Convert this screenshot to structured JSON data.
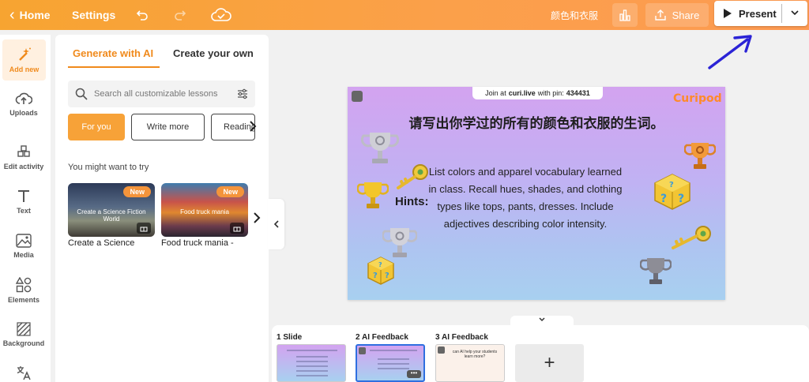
{
  "topbar": {
    "home": "Home",
    "settings": "Settings",
    "title": "颜色和衣服",
    "share": "Share",
    "present": "Present"
  },
  "rail": {
    "items": [
      {
        "label": "Add new",
        "icon": "magic-wand-icon"
      },
      {
        "label": "Uploads",
        "icon": "upload-cloud-icon"
      },
      {
        "label": "Edit activity",
        "icon": "cubes-icon"
      },
      {
        "label": "Text",
        "icon": "text-t-icon"
      },
      {
        "label": "Media",
        "icon": "image-icon"
      },
      {
        "label": "Elements",
        "icon": "shapes-icon"
      },
      {
        "label": "Background",
        "icon": "hatch-icon"
      },
      {
        "label": "",
        "icon": "translate-icon"
      }
    ]
  },
  "panel": {
    "tab_ai": "Generate with AI",
    "tab_own": "Create your own",
    "search_placeholder": "Search all customizable lessons",
    "chips": [
      "For you",
      "Write more",
      "Reading"
    ],
    "try_label": "You might want to try",
    "cards": [
      {
        "title": "Create a Science",
        "badge": "New",
        "caption": "Create a Science Fiction World"
      },
      {
        "title": "Food truck mania -",
        "badge": "New",
        "caption": "Food truck mania"
      }
    ]
  },
  "slide": {
    "join_prefix": "Join at",
    "join_site": "curi.live",
    "join_mid": "with pin:",
    "pin": "434431",
    "logo": "Curipod",
    "question": "请写出你学过的所有的颜色和衣服的生词。",
    "hints_label": "Hints:",
    "hint_text": "List colors and apparel vocabulary learned in class. Recall hues, shades, and clothing types like tops, pants, dresses. Include adjectives describing color intensity."
  },
  "filmstrip": {
    "slides": [
      {
        "label": "1 Slide"
      },
      {
        "label": "2 AI Feedback"
      },
      {
        "label": "3 AI Feedback",
        "mini": "can AI help your students learn more?"
      }
    ],
    "add": "+",
    "more": "•••"
  },
  "colors": {
    "accent": "#f7a238",
    "brand": "#ff8a2a",
    "selection": "#2f6fe0"
  }
}
